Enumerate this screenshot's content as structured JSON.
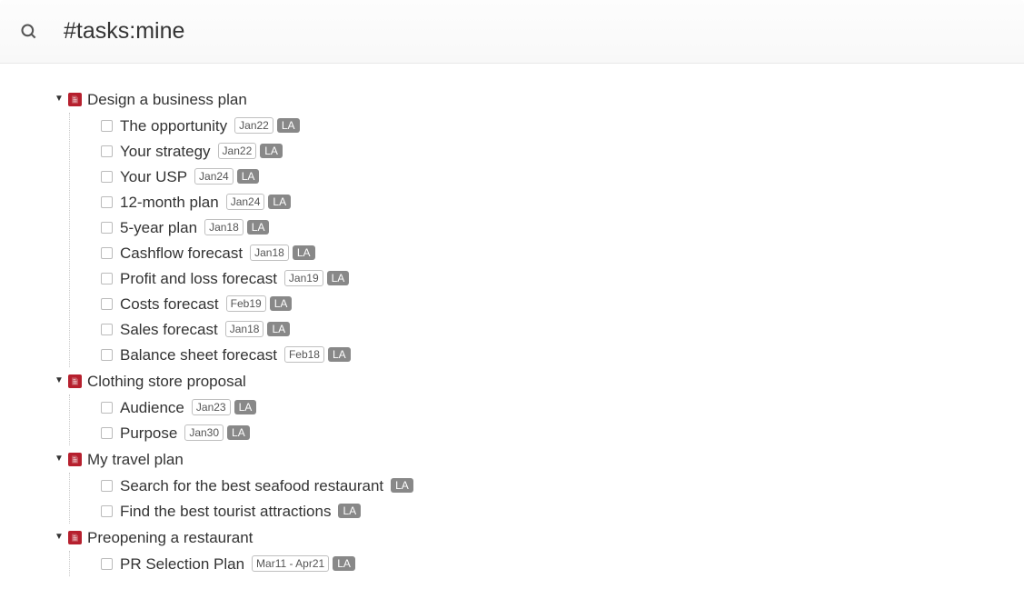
{
  "search": {
    "query": "#tasks:mine"
  },
  "docs": [
    {
      "title": "Design a business plan",
      "tasks": [
        {
          "title": "The opportunity",
          "date": "Jan22",
          "assignee": "LA"
        },
        {
          "title": "Your strategy",
          "date": "Jan22",
          "assignee": "LA"
        },
        {
          "title": "Your USP",
          "date": "Jan24",
          "assignee": "LA"
        },
        {
          "title": "12-month plan",
          "date": "Jan24",
          "assignee": "LA"
        },
        {
          "title": "5-year plan",
          "date": "Jan18",
          "assignee": "LA"
        },
        {
          "title": "Cashflow forecast",
          "date": "Jan18",
          "assignee": "LA"
        },
        {
          "title": "Profit and loss forecast",
          "date": "Jan19",
          "assignee": "LA"
        },
        {
          "title": "Costs forecast",
          "date": "Feb19",
          "assignee": "LA"
        },
        {
          "title": "Sales forecast",
          "date": "Jan18",
          "assignee": "LA"
        },
        {
          "title": "Balance sheet forecast",
          "date": "Feb18",
          "assignee": "LA"
        }
      ]
    },
    {
      "title": "Clothing store proposal",
      "tasks": [
        {
          "title": "Audience",
          "date": "Jan23",
          "assignee": "LA"
        },
        {
          "title": "Purpose",
          "date": "Jan30",
          "assignee": "LA"
        }
      ]
    },
    {
      "title": "My travel plan",
      "tasks": [
        {
          "title": "Search for the best seafood restaurant",
          "date": null,
          "assignee": "LA"
        },
        {
          "title": "Find the best tourist attractions",
          "date": null,
          "assignee": "LA"
        }
      ]
    },
    {
      "title": "Preopening a restaurant",
      "tasks": [
        {
          "title": "PR Selection Plan",
          "date": "Mar11  -  Apr21",
          "assignee": "LA"
        }
      ]
    }
  ]
}
